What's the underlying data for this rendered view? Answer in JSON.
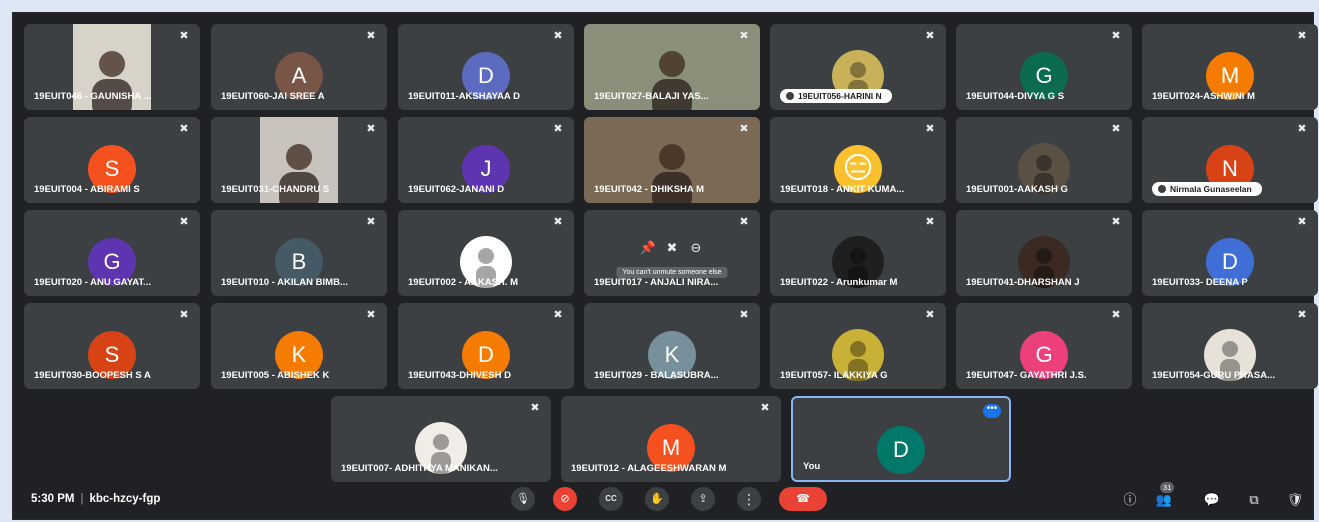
{
  "tiles": [
    {
      "name": "19EUIT046 - GAUNISHA ...",
      "kind": "video",
      "bg": "#d8d3c9"
    },
    {
      "name": "19EUIT060-JAI SREE A",
      "kind": "avatar",
      "letter": "A",
      "color": "#795548"
    },
    {
      "name": "19EUIT011-AKSHAYAA D",
      "kind": "avatar",
      "letter": "D",
      "color": "#5c6bc0"
    },
    {
      "name": "19EUIT027-BALAJI YAS...",
      "kind": "video",
      "bg": "#8a8f7a"
    },
    {
      "name": "19EUIT056-HARINI N",
      "kind": "photo-pill",
      "bg": "#c9b15a"
    },
    {
      "name": "19EUIT044-DIVYA G S",
      "kind": "avatar",
      "letter": "G",
      "color": "#0b6b4f"
    },
    {
      "name": "19EUIT024-ASHWINI M",
      "kind": "avatar",
      "letter": "M",
      "color": "#f57c00"
    },
    {
      "name": "19EUIT004 - ABIRAMI S",
      "kind": "avatar",
      "letter": "S",
      "color": "#f4511e"
    },
    {
      "name": "19EUIT031-CHANDRU S",
      "kind": "video",
      "bg": "#c8c4bd"
    },
    {
      "name": "19EUIT062-JANANI D",
      "kind": "avatar",
      "letter": "J",
      "color": "#5e35b1"
    },
    {
      "name": "19EUIT042 - DHIKSHA M",
      "kind": "video",
      "bg": "#7a6a55"
    },
    {
      "name": "19EUIT018 - ANKIT KUMA...",
      "kind": "emoji",
      "emoji": "😑"
    },
    {
      "name": "19EUIT001-AAKASH G",
      "kind": "photo",
      "bg": "#5a5044"
    },
    {
      "name": "Nirmala Gunaseelan",
      "kind": "avatar-pill",
      "letter": "N",
      "color": "#d84315"
    },
    {
      "name": "19EUIT020 - ANU GAYAT...",
      "kind": "avatar",
      "letter": "G",
      "color": "#5e35b1"
    },
    {
      "name": "19EUIT010 - AKILAN BIMB...",
      "kind": "avatar",
      "letter": "B",
      "color": "#455a64"
    },
    {
      "name": "19EUIT002 - AAKASH. M",
      "kind": "photo",
      "bg": "#ffffff"
    },
    {
      "name": "19EUIT017 - ANJALI NIRA...",
      "kind": "hover",
      "tooltip": "You can't unmute someone else"
    },
    {
      "name": "19EUIT022 - Arunkumar M",
      "kind": "photo",
      "bg": "#1f1f1f"
    },
    {
      "name": "19EUIT041-DHARSHAN J",
      "kind": "photo",
      "bg": "#3a2a22"
    },
    {
      "name": "19EUIT033- DEENA P",
      "kind": "avatar",
      "letter": "D",
      "color": "#3f6fd6"
    },
    {
      "name": "19EUIT030-BOOPESH S A",
      "kind": "avatar",
      "letter": "S",
      "color": "#d84315"
    },
    {
      "name": "19EUIT005 - ABISHEK K",
      "kind": "avatar",
      "letter": "K",
      "color": "#f57c00"
    },
    {
      "name": "19EUIT043-DHIVESH D",
      "kind": "avatar",
      "letter": "D",
      "color": "#f57c00"
    },
    {
      "name": "19EUIT029 - BALASUBRA...",
      "kind": "avatar",
      "letter": "K",
      "color": "#78909c"
    },
    {
      "name": "19EUIT057- ILAKKIYA G",
      "kind": "photo",
      "bg": "#c9b037"
    },
    {
      "name": "19EUIT047- GAYATHRI J.S.",
      "kind": "avatar",
      "letter": "G",
      "color": "#ec407a"
    },
    {
      "name": "19EUIT054-GURU PRASA...",
      "kind": "photo",
      "bg": "#e7e2d8"
    },
    {
      "name": "19EUIT007- ADHITHYA MANIKAN...",
      "kind": "photo",
      "bg": "#f0ece6"
    },
    {
      "name": "19EUIT012 - ALAGEESHWARAN M",
      "kind": "avatar",
      "letter": "M",
      "color": "#f4511e"
    },
    {
      "name": "You",
      "kind": "you",
      "letter": "D",
      "color": "#00796b"
    }
  ],
  "bar": {
    "time": "5:30 PM",
    "separator": "|",
    "code": "kbc-hzcy-fgp",
    "people_count": "31"
  },
  "icons": {
    "mic": "🎙",
    "camera_off": "⊘",
    "captions": "CC",
    "raise_hand": "✋",
    "present": "⇪",
    "more": "⋮",
    "end_call": "☎",
    "info": "ⓘ",
    "people": "👥",
    "chat": "💬",
    "activities": "⧉",
    "host_controls": "🛡",
    "muted": "✖",
    "pin": "📌",
    "remove": "⊖",
    "options_dots": "•••"
  }
}
